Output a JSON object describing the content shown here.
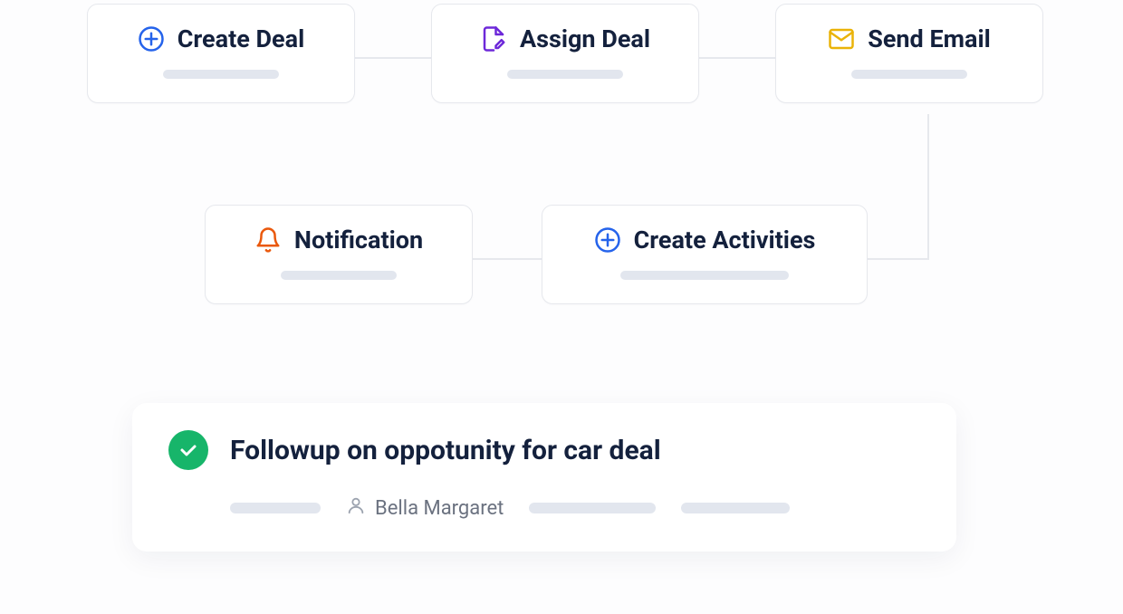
{
  "workflow": {
    "nodes": {
      "create_deal": {
        "label": "Create Deal",
        "icon": "plus-circle",
        "icon_color": "#2563eb"
      },
      "assign_deal": {
        "label": "Assign Deal",
        "icon": "file-edit",
        "icon_color": "#6d28d9"
      },
      "send_email": {
        "label": "Send Email",
        "icon": "mail",
        "icon_color": "#eab308"
      },
      "notification": {
        "label": "Notification",
        "icon": "bell",
        "icon_color": "#ea580c"
      },
      "create_activities": {
        "label": "Create Activities",
        "icon": "plus-circle",
        "icon_color": "#2563eb"
      }
    }
  },
  "task": {
    "status": "complete",
    "title": "Followup on oppotunity for car deal",
    "assignee": "Bella Margaret"
  }
}
